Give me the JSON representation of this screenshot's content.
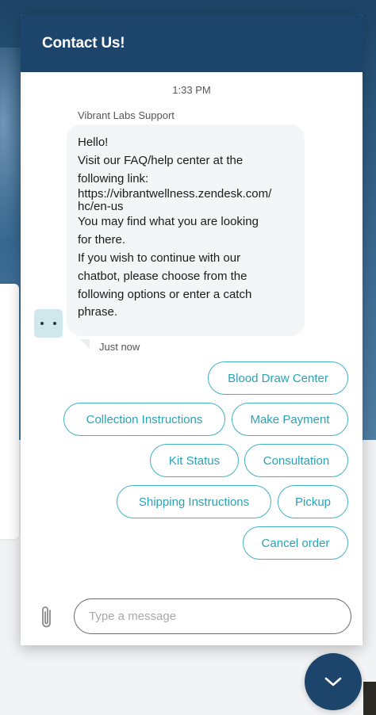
{
  "widget": {
    "title": "Contact Us!",
    "accent": "#1d446a",
    "quick_reply_color": "#42b2c2"
  },
  "conversation": {
    "timestamp": "1:33 PM",
    "agent_name": "Vibrant Labs Support",
    "message_lines": [
      "Hello!",
      "Visit our FAQ/help center at the",
      "following link:",
      "https://vibrantwellness.zendesk.com/",
      "hc/en-us",
      "You may find what you are looking",
      "for there.",
      "If you wish to continue with our",
      "chatbot, please choose from the",
      "following options or enter a catch",
      "phrase."
    ],
    "message_status": "Just now"
  },
  "quick_replies": [
    "Blood Draw Center",
    "Collection Instructions",
    "Make Payment",
    "Kit Status",
    "Consultation",
    "Shipping Instructions",
    "Pickup",
    "Cancel order"
  ],
  "composer": {
    "placeholder": "Type a message",
    "attach_icon": "paperclip-icon"
  },
  "launcher": {
    "icon": "chevron-down-icon"
  }
}
